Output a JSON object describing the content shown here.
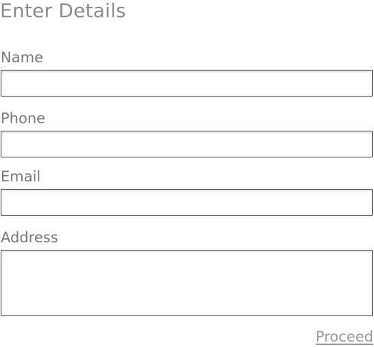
{
  "form": {
    "title": "Enter Details",
    "fields": [
      {
        "label": "Name",
        "value": "",
        "placeholder": ""
      },
      {
        "label": "Phone",
        "value": "",
        "placeholder": ""
      },
      {
        "label": "Email",
        "value": "",
        "placeholder": ""
      },
      {
        "label": "Address",
        "value": "",
        "placeholder": ""
      }
    ],
    "proceed_label": "Proceed"
  },
  "colors": {
    "text": "#777777",
    "title": "#8a8a8a",
    "link": "#999999",
    "field_border": "#333333"
  }
}
